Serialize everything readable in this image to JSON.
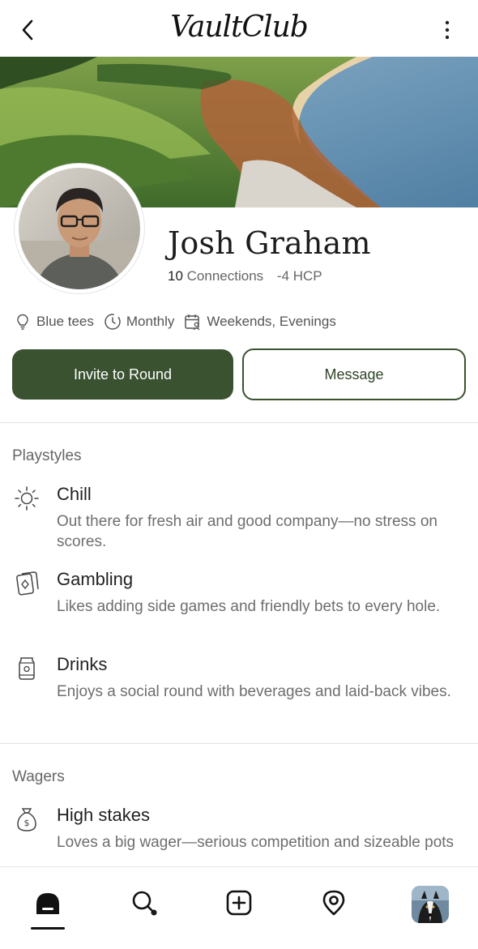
{
  "header": {
    "logo_text": "VaultClub",
    "back_icon": "chevron-left-icon",
    "more_icon": "more-vertical-icon"
  },
  "profile": {
    "name": "Josh Graham",
    "connections_count": "10",
    "connections_label": "Connections",
    "handicap": "-4 HCP"
  },
  "prefs": [
    {
      "icon": "lightbulb-icon",
      "label": "Blue tees"
    },
    {
      "icon": "clock-icon",
      "label": "Monthly"
    },
    {
      "icon": "calendar-user-icon",
      "label": "Weekends, Evenings"
    }
  ],
  "actions": {
    "invite_label": "Invite to Round",
    "message_label": "Message"
  },
  "playstyles": {
    "title": "Playstyles",
    "items": [
      {
        "icon": "sun-icon",
        "title": "Chill",
        "desc": "Out there for fresh air and good company—no stress on scores."
      },
      {
        "icon": "playing-cards-icon",
        "title": "Gambling",
        "desc": "Likes adding side games and friendly bets to every hole."
      },
      {
        "icon": "drink-can-icon",
        "title": "Drinks",
        "desc": "Enjoys a social round with beverages and laid-back vibes."
      }
    ]
  },
  "wagers": {
    "title": "Wagers",
    "items": [
      {
        "icon": "money-bag-icon",
        "title": "High stakes",
        "desc": "Loves a big wager—serious competition and sizeable pots"
      }
    ]
  },
  "nav": {
    "items": [
      "home-icon",
      "search-icon",
      "add-icon",
      "location-pin-icon",
      "profile-avatar"
    ],
    "active": "home-icon"
  },
  "colors": {
    "accent": "#3a5230",
    "text_muted": "#6e6e6e"
  }
}
